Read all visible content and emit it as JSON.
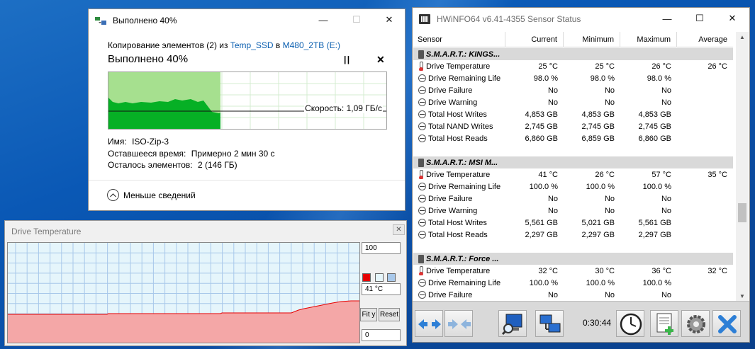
{
  "copy_dialog": {
    "title": "Выполнено 40%",
    "subtitle_prefix": "Копирование элементов (2) из",
    "source": "Temp_SSD",
    "to_word": "в",
    "destination": "M480_2TB (E:)",
    "heading": "Выполнено 40%",
    "speed": "Скорость: 1,09 ГБ/с",
    "progress_fraction": 0.4,
    "name_label": "Имя:",
    "name_value": "ISO-Zip-3",
    "time_label": "Оставшееся время:",
    "time_value": "Примерно 2 мин 30 с",
    "items_label": "Осталось элементов:",
    "items_value": "2 (146 ГБ)",
    "less_details": "Меньше сведений"
  },
  "graph_window": {
    "title": "Drive Temperature",
    "max_value": "100",
    "current_value": "41 °C",
    "min_value": "0",
    "fit_label": "Fit y",
    "reset_label": "Reset",
    "colors": {
      "line": "#e60000",
      "fill": "#f4a7a7",
      "background": "#e5f5fb",
      "grid": "#a8c8ea"
    }
  },
  "hwinfo": {
    "title": "HWiNFO64 v6.41-4355 Sensor Status",
    "columns": [
      "Sensor",
      "Current",
      "Minimum",
      "Maximum",
      "Average"
    ],
    "rows": [
      {
        "type": "group",
        "name": "S.M.A.R.T.: KINGS..."
      },
      {
        "type": "temp",
        "name": "Drive Temperature",
        "current": "25 °C",
        "min": "25 °C",
        "max": "26 °C",
        "avg": "26 °C"
      },
      {
        "type": "gauge",
        "name": "Drive Remaining Life",
        "current": "98.0 %",
        "min": "98.0 %",
        "max": "98.0 %",
        "avg": ""
      },
      {
        "type": "gauge",
        "name": "Drive Failure",
        "current": "No",
        "min": "No",
        "max": "No",
        "avg": ""
      },
      {
        "type": "gauge",
        "name": "Drive Warning",
        "current": "No",
        "min": "No",
        "max": "No",
        "avg": ""
      },
      {
        "type": "gauge",
        "name": "Total Host Writes",
        "current": "4,853 GB",
        "min": "4,853 GB",
        "max": "4,853 GB",
        "avg": ""
      },
      {
        "type": "gauge",
        "name": "Total NAND Writes",
        "current": "2,745 GB",
        "min": "2,745 GB",
        "max": "2,745 GB",
        "avg": ""
      },
      {
        "type": "gauge",
        "name": "Total Host Reads",
        "current": "6,860 GB",
        "min": "6,859 GB",
        "max": "6,860 GB",
        "avg": ""
      },
      {
        "type": "blank",
        "name": ""
      },
      {
        "type": "group",
        "name": "S.M.A.R.T.: MSI M..."
      },
      {
        "type": "temp",
        "name": "Drive Temperature",
        "current": "41 °C",
        "min": "26 °C",
        "max": "57 °C",
        "avg": "35 °C"
      },
      {
        "type": "gauge",
        "name": "Drive Remaining Life",
        "current": "100.0 %",
        "min": "100.0 %",
        "max": "100.0 %",
        "avg": ""
      },
      {
        "type": "gauge",
        "name": "Drive Failure",
        "current": "No",
        "min": "No",
        "max": "No",
        "avg": ""
      },
      {
        "type": "gauge",
        "name": "Drive Warning",
        "current": "No",
        "min": "No",
        "max": "No",
        "avg": ""
      },
      {
        "type": "gauge",
        "name": "Total Host Writes",
        "current": "5,561 GB",
        "min": "5,021 GB",
        "max": "5,561 GB",
        "avg": ""
      },
      {
        "type": "gauge",
        "name": "Total Host Reads",
        "current": "2,297 GB",
        "min": "2,297 GB",
        "max": "2,297 GB",
        "avg": ""
      },
      {
        "type": "blank",
        "name": ""
      },
      {
        "type": "group",
        "name": "S.M.A.R.T.: Force ..."
      },
      {
        "type": "temp",
        "name": "Drive Temperature",
        "current": "32 °C",
        "min": "30 °C",
        "max": "36 °C",
        "avg": "32 °C"
      },
      {
        "type": "gauge",
        "name": "Drive Remaining Life",
        "current": "100.0 %",
        "min": "100.0 %",
        "max": "100.0 %",
        "avg": ""
      },
      {
        "type": "gauge",
        "name": "Drive Failure",
        "current": "No",
        "min": "No",
        "max": "No",
        "avg": ""
      }
    ],
    "elapsed": "0:30:44",
    "toolbar_icons": [
      "expand-arrows-icon",
      "collapse-arrows-icon",
      "monitor-search-icon",
      "network-icon",
      "clock-icon",
      "report-add-icon",
      "settings-gear-icon",
      "close-x-icon"
    ]
  }
}
